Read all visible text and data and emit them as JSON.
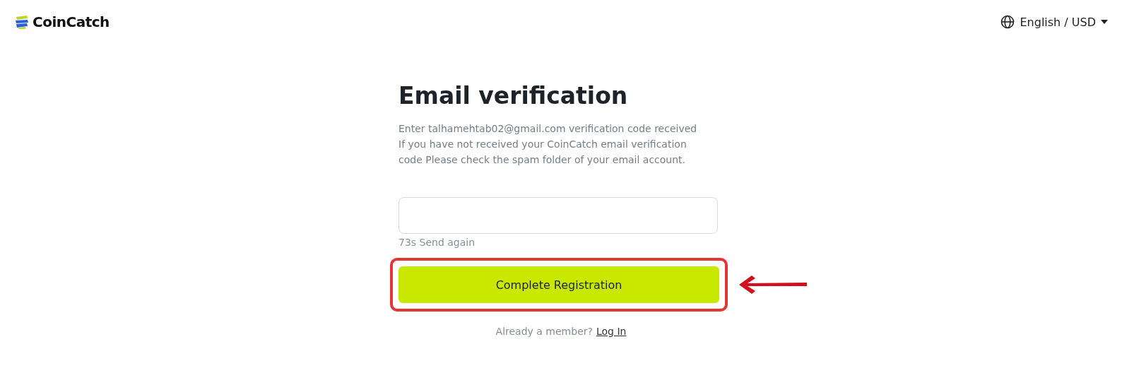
{
  "header": {
    "brand": "CoinCatch",
    "language": "English / USD"
  },
  "form": {
    "title": "Email verification",
    "paragraphs": [
      "Enter talhamehtab02@gmail.com verification code received",
      "If you have not received your CoinCatch email verification code Please check the spam folder of your email account."
    ],
    "resend": "73s Send again",
    "submit": "Complete Registration",
    "footer": {
      "text": "Already a member?",
      "link": "Log In"
    }
  }
}
